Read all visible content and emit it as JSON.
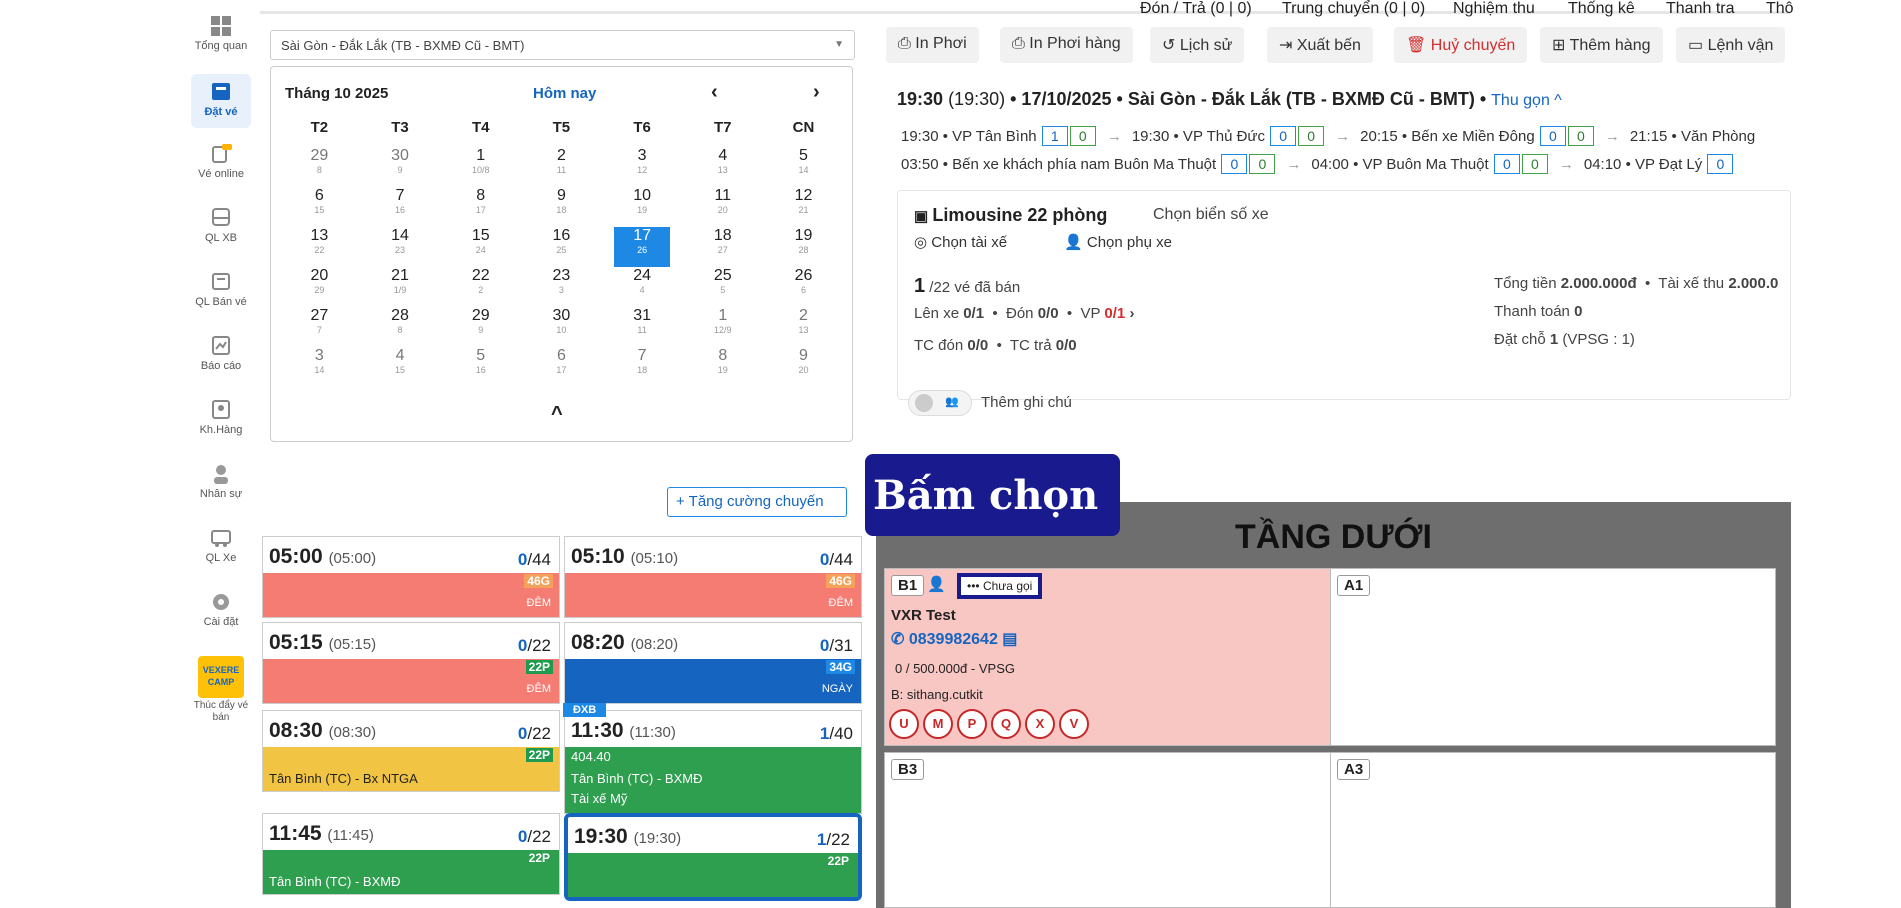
{
  "sidebar": {
    "items": [
      {
        "label": "Tổng quan"
      },
      {
        "label": "Đặt vé"
      },
      {
        "label": "Vé online"
      },
      {
        "label": "QL XB"
      },
      {
        "label": "QL Bán vé"
      },
      {
        "label": "Báo cáo"
      },
      {
        "label": "Kh.Hàng"
      },
      {
        "label": "Nhân sự"
      },
      {
        "label": "QL Xe"
      },
      {
        "label": "Cài đặt"
      },
      {
        "label": "Thúc đẩy vé bán",
        "logo_text": "VEXERE CAMP"
      }
    ]
  },
  "route_select": {
    "value": "Sài Gòn - Đắk Lắk (TB - BXMĐ Cũ - BMT)"
  },
  "calendar": {
    "month_label": "Tháng 10 2025",
    "today_label": "Hôm nay",
    "weekdays": [
      "T2",
      "T3",
      "T4",
      "T5",
      "T6",
      "T7",
      "CN"
    ],
    "weeks": [
      [
        [
          "29",
          "8"
        ],
        [
          "30",
          "9"
        ],
        [
          "1",
          "10/8"
        ],
        [
          "2",
          "11"
        ],
        [
          "3",
          "12"
        ],
        [
          "4",
          "13"
        ],
        [
          "5",
          "14"
        ]
      ],
      [
        [
          "6",
          "15"
        ],
        [
          "7",
          "16"
        ],
        [
          "8",
          "17"
        ],
        [
          "9",
          "18"
        ],
        [
          "10",
          "19"
        ],
        [
          "11",
          "20"
        ],
        [
          "12",
          "21"
        ]
      ],
      [
        [
          "13",
          "22"
        ],
        [
          "14",
          "23"
        ],
        [
          "15",
          "24"
        ],
        [
          "16",
          "25"
        ],
        [
          "17",
          "26"
        ],
        [
          "18",
          "27"
        ],
        [
          "19",
          "28"
        ]
      ],
      [
        [
          "20",
          "29"
        ],
        [
          "21",
          "1/9"
        ],
        [
          "22",
          "2"
        ],
        [
          "23",
          "3"
        ],
        [
          "24",
          "4"
        ],
        [
          "25",
          "5"
        ],
        [
          "26",
          "6"
        ]
      ],
      [
        [
          "27",
          "7"
        ],
        [
          "28",
          "8"
        ],
        [
          "29",
          "9"
        ],
        [
          "30",
          "10"
        ],
        [
          "31",
          "11"
        ],
        [
          "1",
          "12/9"
        ],
        [
          "2",
          "13"
        ]
      ],
      [
        [
          "3",
          "14"
        ],
        [
          "4",
          "15"
        ],
        [
          "5",
          "16"
        ],
        [
          "6",
          "17"
        ],
        [
          "7",
          "18"
        ],
        [
          "8",
          "19"
        ],
        [
          "9",
          "20"
        ]
      ]
    ],
    "selected": "17"
  },
  "add_trip_label": "Tăng cường chuyến",
  "trips": [
    {
      "time": "05:00",
      "sub": "(05:00)",
      "sold": "0",
      "total": "/44",
      "badge": "46G",
      "tag": "ĐÊM",
      "route": "",
      "color": "#f47c72",
      "badge_color": "#f6a15a"
    },
    {
      "time": "05:10",
      "sub": "(05:10)",
      "sold": "0",
      "total": "/44",
      "badge": "46G",
      "tag": "ĐÊM",
      "route": "",
      "color": "#f47c72",
      "badge_color": "#f6a15a"
    },
    {
      "time": "05:15",
      "sub": "(05:15)",
      "sold": "0",
      "total": "/22",
      "badge": "22P",
      "tag": "ĐÊM",
      "route": "",
      "color": "#f47c72",
      "badge_color": "#1e9b4f"
    },
    {
      "time": "08:20",
      "sub": "(08:20)",
      "sold": "0",
      "total": "/31",
      "badge": "34G",
      "tag": "NGÀY",
      "route": "",
      "color": "#1565c0",
      "badge_color": "#1e88e5"
    },
    {
      "time": "08:30",
      "sub": "(08:30)",
      "sold": "0",
      "total": "/22",
      "badge": "22P",
      "tag": "",
      "route": "Tân Bình (TC) - Bx NTGA",
      "color": "#f2c443",
      "badge_color": "#1e9b4f"
    },
    {
      "time": "11:30",
      "sub": "(11:30)",
      "sold": "1",
      "total": "/40",
      "badge": "",
      "tag": "",
      "route": "404.40",
      "route2": "Tân Bình (TC) - BXMĐ",
      "route3": "Tài xế Mỹ",
      "color": "#2e9e4f",
      "badge_color": "#1e9b4f"
    },
    {
      "time": "11:45",
      "sub": "(11:45)",
      "sold": "0",
      "total": "/22",
      "badge": "22P",
      "tag": "",
      "route": "Tân Bình (TC) - BXMĐ",
      "color": "#2e9e4f",
      "badge_color": "#2e9e4f"
    },
    {
      "time": "19:30",
      "sub": "(19:30)",
      "sold": "1",
      "total": "/22",
      "badge": "22P",
      "tag": "",
      "route": "",
      "color": "#2e9e4f",
      "badge_color": "#2e9e4f"
    }
  ],
  "dxb_label": "ĐXB",
  "toolbar": [
    {
      "label": "In Phơi",
      "icon": "printer-icon"
    },
    {
      "label": "In Phơi hàng",
      "icon": "printer-icon"
    },
    {
      "label": "Lịch sử",
      "icon": "history-icon"
    },
    {
      "label": "Xuất bến",
      "icon": "exit-icon"
    },
    {
      "label": "Huỷ chuyến",
      "icon": "trash-icon"
    },
    {
      "label": "Thêm hàng",
      "icon": "plus-box-icon"
    },
    {
      "label": "Lệnh vận",
      "icon": "document-icon"
    }
  ],
  "detail": {
    "time": "19:30",
    "time_sub": "(19:30)",
    "title_rest": "• 17/10/2025 • Sài Gòn - Đắk Lắk (TB - BXMĐ Cũ - BMT) •",
    "collapse": "Thu gọn ^",
    "stops_row1": [
      {
        "label": "19:30 • VP Tân Bình",
        "a": "1",
        "b": "0"
      },
      {
        "label": "19:30 • VP Thủ Đức",
        "a": "0",
        "b": "0"
      },
      {
        "label": "20:15 • Bến xe Miền Đông",
        "a": "0",
        "b": "0"
      },
      {
        "label": "21:15 • Văn Phòng",
        "a": "",
        "b": ""
      }
    ],
    "stops_row2": [
      {
        "label": "03:50 • Bến xe khách phía nam Buôn Ma Thuột",
        "a": "0",
        "b": "0"
      },
      {
        "label": "04:00 • VP Buôn Ma Thuột",
        "a": "0",
        "b": "0"
      },
      {
        "label": "04:10 • VP Đạt Lý",
        "a": "0",
        "b": ""
      }
    ],
    "vehicle": "Limousine 22 phòng",
    "plate": "Chọn biển số xe",
    "driver": "Chọn tài xế",
    "assistant": "Chọn phụ xe",
    "sold_count": "1",
    "sold_rest": "/22 vé đã bán",
    "onboard_label": "Lên xe",
    "onboard": "0/1",
    "pickup_label": "Đón",
    "pickup": "0/0",
    "office_label": "VP",
    "office": "0/1",
    "tc_pickup_label": "TC đón",
    "tc_pickup": "0/0",
    "tc_drop_label": "TC trả",
    "tc_drop": "0/0",
    "total_label": "Tổng tiền",
    "total": "2.000.000đ",
    "driver_collect_label": "Tài xế thu",
    "driver_collect": "2.000.0",
    "paid_label": "Thanh toán",
    "paid": "0",
    "reserved_label": "Đặt chỗ",
    "reserved": "1",
    "reserved_sub": "(VPSG : 1)",
    "note_label": "Thêm ghi chú"
  },
  "tabs": [
    "Đón / Trả (0 | 0)",
    "Trung chuyển (0 | 0)",
    "Nghiệm thu",
    "Thống kê",
    "Thanh tra",
    "Thô"
  ],
  "callout": "Bấm chọn",
  "seatmap": {
    "floor": "TẦNG DƯỚI",
    "seats": [
      {
        "code": "B1",
        "status": "Chưa gọi",
        "name": "VXR Test",
        "phone": "0839982642",
        "price": "0 / 500.000đ",
        "agent": "VPSG",
        "note": "B: sithang.cutkit",
        "actions": [
          "U",
          "M",
          "P",
          "Q",
          "X",
          "V"
        ]
      },
      {
        "code": "A1"
      },
      {
        "code": "B3"
      },
      {
        "code": "A3"
      }
    ]
  }
}
